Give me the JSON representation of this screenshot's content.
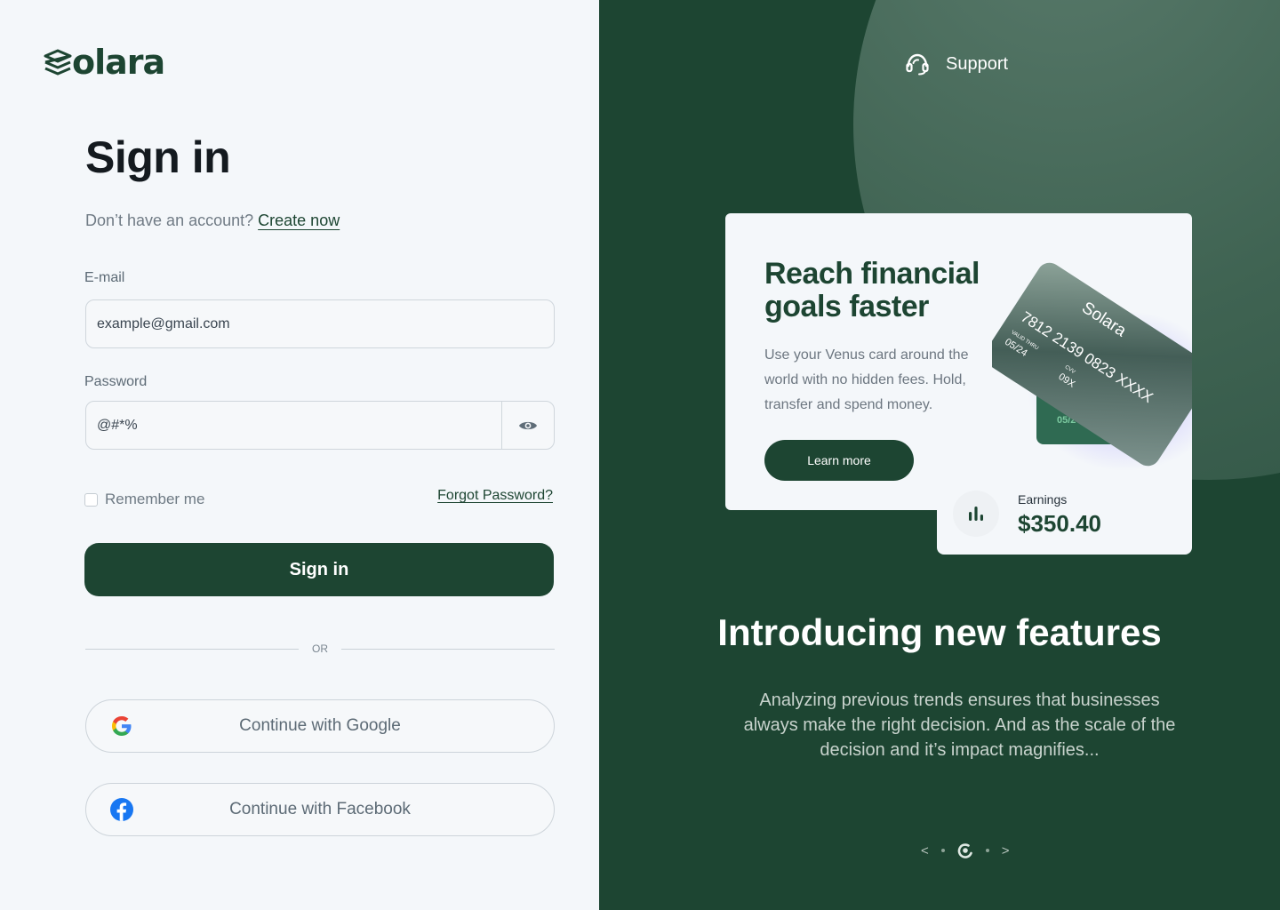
{
  "brand": {
    "name": "olara",
    "accent": "#1d4532",
    "logo_icon": "stacked-layers-icon"
  },
  "signin": {
    "title": "Sign in",
    "no_account_text": "Don’t have an account?",
    "create_link": "Create now",
    "email_label": "E-mail",
    "email_placeholder": "example@gmail.com",
    "password_label": "Password",
    "password_value": "@#*%",
    "remember_label": "Remember me",
    "forgot_link": "Forgot Password?",
    "submit_label": "Sign in",
    "or_label": "OR",
    "google_label": "Continue with Google",
    "facebook_label": "Continue with Facebook"
  },
  "promo": {
    "support_label": "Support",
    "card_title": "Reach financial goals faster",
    "card_text": "Use your Venus card around the world with no hidden fees. Hold, transfer and spend money.",
    "learn_more": "Learn more",
    "credit_card": {
      "brand": "Solara",
      "number": "7812 2139 0823 XXXX",
      "valid_thru_label": "VALID THRU",
      "valid_thru": "05/24",
      "cvv_label": "CVV",
      "cvv": "09X",
      "back_card_date": "05/2"
    },
    "earnings_label": "Earnings",
    "earnings_value": "$350.40",
    "intro_title": "Introducing new features",
    "intro_text": "Analyzing previous trends ensures that businesses always make the right decision. And as the scale of the decision and it’s impact magnifies...",
    "pager": {
      "prev": "<",
      "next": ">",
      "total": 3,
      "active": 2
    }
  }
}
